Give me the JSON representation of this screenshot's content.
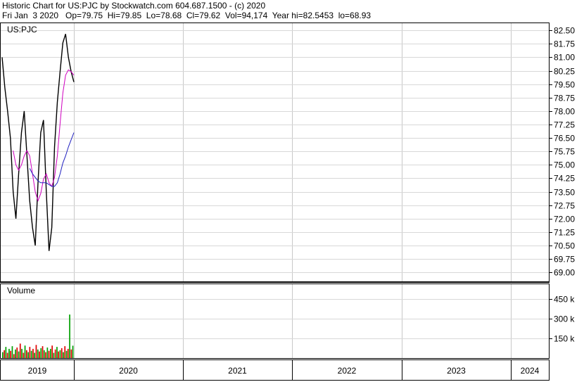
{
  "header": {
    "line1": "Historic Chart for US:PJC by Stockwatch.com 604.687.1500 - (c) 2020",
    "line2": "Fri Jan  3 2020   Op=79.75  Hi=79.85  Lo=78.68  Cl=79.62  Vol=94,174  Year hi=82.5453  lo=68.93"
  },
  "price_panel": {
    "label": "US:PJC"
  },
  "volume_panel": {
    "label": "Volume"
  },
  "chart_data": [
    {
      "type": "line",
      "panel": "price",
      "symbol": "US:PJC",
      "ylim": [
        68.5,
        82.9
      ],
      "yticks": [
        "82.50",
        "81.75",
        "81.00",
        "80.25",
        "79.50",
        "78.75",
        "78.00",
        "77.25",
        "76.50",
        "75.75",
        "75.00",
        "74.25",
        "73.50",
        "72.75",
        "72.00",
        "71.25",
        "70.50",
        "69.75",
        "69.00"
      ],
      "x": [
        "2019-01-02",
        "2019-01-16",
        "2019-01-30",
        "2019-02-13",
        "2019-02-27",
        "2019-03-13",
        "2019-03-27",
        "2019-04-10",
        "2019-04-24",
        "2019-05-08",
        "2019-05-22",
        "2019-06-05",
        "2019-06-19",
        "2019-07-03",
        "2019-07-17",
        "2019-07-31",
        "2019-08-14",
        "2019-08-28",
        "2019-09-11",
        "2019-09-25",
        "2019-10-09",
        "2019-10-23",
        "2019-11-06",
        "2019-11-20",
        "2019-12-04",
        "2019-12-18",
        "2020-01-03"
      ],
      "series": [
        {
          "role": "daily price",
          "color": "#000000",
          "values": [
            81.0,
            79.3,
            78.0,
            76.5,
            73.5,
            72.0,
            74.5,
            76.8,
            78.0,
            75.5,
            73.0,
            71.5,
            70.5,
            74.0,
            76.8,
            77.5,
            73.5,
            70.2,
            71.5,
            76.0,
            78.5,
            80.2,
            81.8,
            82.3,
            81.0,
            80.2,
            79.62
          ]
        },
        {
          "role": "short moving average",
          "color": "#d000c0",
          "values": [
            null,
            null,
            null,
            null,
            75.8,
            75.0,
            74.7,
            75.0,
            75.5,
            75.8,
            75.5,
            74.5,
            73.5,
            73.0,
            73.4,
            74.2,
            74.5,
            74.0,
            73.8,
            74.3,
            75.5,
            77.3,
            79.0,
            80.0,
            80.3,
            80.2,
            80.0
          ]
        },
        {
          "role": "long moving average",
          "color": "#2020c0",
          "values": [
            null,
            null,
            null,
            null,
            null,
            null,
            null,
            null,
            null,
            null,
            74.8,
            74.5,
            74.3,
            74.1,
            74.0,
            74.0,
            74.0,
            73.9,
            73.8,
            73.8,
            74.0,
            74.5,
            75.1,
            75.5,
            76.0,
            76.4,
            76.8
          ]
        }
      ]
    },
    {
      "type": "bar",
      "panel": "volume",
      "ylim": [
        0,
        560
      ],
      "yticks": [
        "450 k",
        "300 k",
        "150 k"
      ],
      "values": [
        45,
        60,
        85,
        40,
        70,
        55,
        90,
        30,
        65,
        80,
        50,
        110,
        70,
        40,
        95,
        60,
        45,
        85,
        55,
        70,
        40,
        100,
        65,
        50,
        75,
        90,
        60,
        45,
        80,
        55,
        70,
        95,
        40,
        65,
        85,
        50,
        60,
        75,
        45,
        90,
        55,
        70,
        330,
        65,
        94
      ],
      "colors": [
        "#00a000",
        "#e00000"
      ]
    }
  ],
  "x_axis": {
    "years": [
      "2019",
      "2020",
      "2021",
      "2022",
      "2023",
      "2024"
    ]
  }
}
